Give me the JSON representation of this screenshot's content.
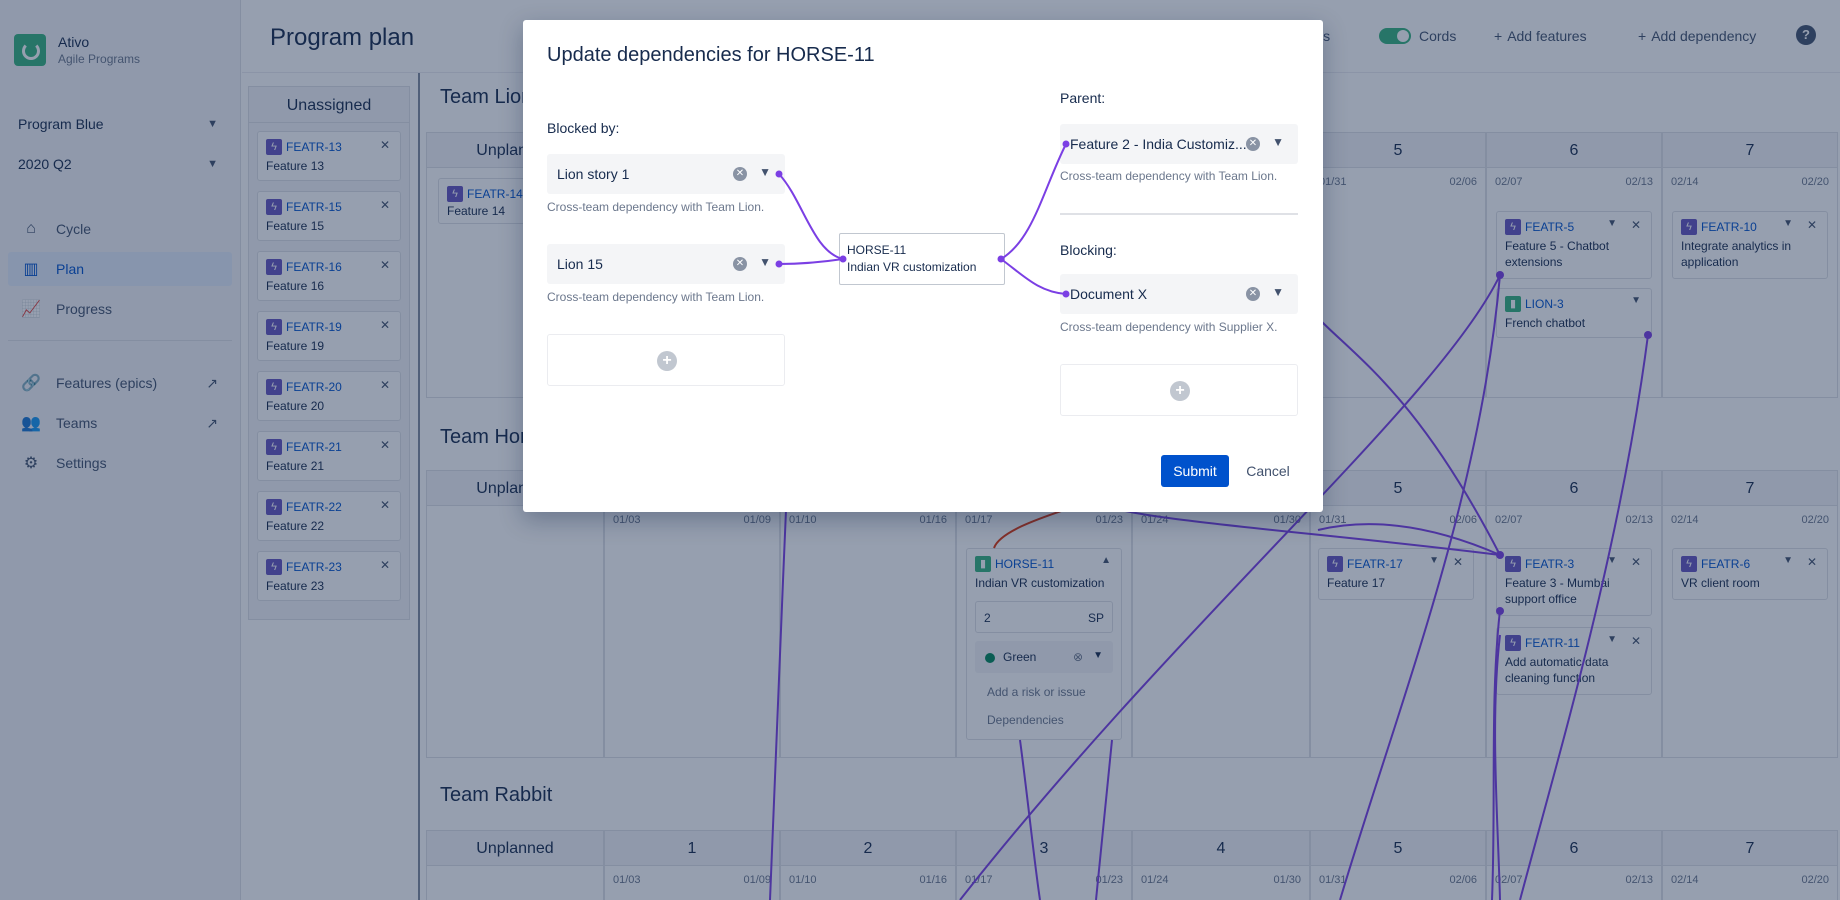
{
  "brand": {
    "name": "Ativo",
    "sub": "Agile Programs"
  },
  "selectors": {
    "program": "Program Blue",
    "quarter": "2020 Q2"
  },
  "nav": {
    "cycle": "Cycle",
    "plan": "Plan",
    "progress": "Progress",
    "features": "Features (epics)",
    "teams": "Teams",
    "settings": "Settings"
  },
  "topbar": {
    "title": "Program plan",
    "partial_item": "ls",
    "cords": "Cords",
    "add_features": "Add features",
    "add_dependency": "Add dependency",
    "help": "?"
  },
  "unassigned": {
    "title": "Unassigned",
    "items": [
      {
        "key": "FEATR-13",
        "name": "Feature 13"
      },
      {
        "key": "FEATR-15",
        "name": "Feature 15"
      },
      {
        "key": "FEATR-16",
        "name": "Feature 16"
      },
      {
        "key": "FEATR-19",
        "name": "Feature 19"
      },
      {
        "key": "FEATR-20",
        "name": "Feature 20"
      },
      {
        "key": "FEATR-21",
        "name": "Feature 21"
      },
      {
        "key": "FEATR-22",
        "name": "Feature 22"
      },
      {
        "key": "FEATR-23",
        "name": "Feature 23"
      }
    ]
  },
  "teams": {
    "lion": "Team Lion",
    "horse": "Team Horse",
    "rabbit": "Team Rabbit"
  },
  "board": {
    "unplanned": "Unplanned",
    "sprints": [
      "1",
      "2",
      "3",
      "4",
      "5",
      "6",
      "7"
    ],
    "dates": [
      [
        "01/03",
        "01/09"
      ],
      [
        "01/10",
        "01/16"
      ],
      [
        "01/17",
        "01/23"
      ],
      [
        "01/24",
        "01/30"
      ],
      [
        "01/31",
        "02/06"
      ],
      [
        "02/07",
        "02/13"
      ],
      [
        "02/14",
        "02/20"
      ]
    ]
  },
  "cards": {
    "featr14": {
      "key": "FEATR-14",
      "name": "Feature 14"
    },
    "featr5": {
      "key": "FEATR-5",
      "name": "Feature 5 - Chatbot extensions"
    },
    "lion3": {
      "key": "LION-3",
      "name": "French chatbot"
    },
    "featr10": {
      "key": "FEATR-10",
      "name": "Integrate analytics in application"
    },
    "horse11": {
      "key": "HORSE-11",
      "name": "Indian VR customization",
      "points": "2",
      "points_unit": "SP",
      "status": "Green",
      "risk_link": "Add a risk or issue",
      "dependencies_link": "Dependencies"
    },
    "featr17": {
      "key": "FEATR-17",
      "name": "Feature 17"
    },
    "featr3": {
      "key": "FEATR-3",
      "name": "Feature 3 - Mumbai support office"
    },
    "featr11": {
      "key": "FEATR-11",
      "name": "Add automatic data cleaning function"
    },
    "featr6": {
      "key": "FEATR-6",
      "name": "VR client room"
    }
  },
  "modal": {
    "title": "Update dependencies for HORSE-11",
    "blocked_by_label": "Blocked by:",
    "blocked_by": [
      {
        "value": "Lion story 1",
        "hint": "Cross-team dependency with Team Lion."
      },
      {
        "value": "Lion 15",
        "hint": "Cross-team dependency with Team Lion."
      }
    ],
    "center": {
      "key": "HORSE-11",
      "name": "Indian VR customization"
    },
    "parent_label": "Parent:",
    "parent": {
      "value": "Feature 2 - India Customiz...",
      "hint": "Cross-team dependency with Team Lion."
    },
    "blocking_label": "Blocking:",
    "blocking": {
      "value": "Document X",
      "hint": "Cross-team dependency with Supplier X."
    },
    "submit": "Submit",
    "cancel": "Cancel"
  },
  "colors": {
    "accent": "#0052cc",
    "cord": "#7b3fe4",
    "status_green": "#00875a",
    "overlay": "#172b4d"
  }
}
